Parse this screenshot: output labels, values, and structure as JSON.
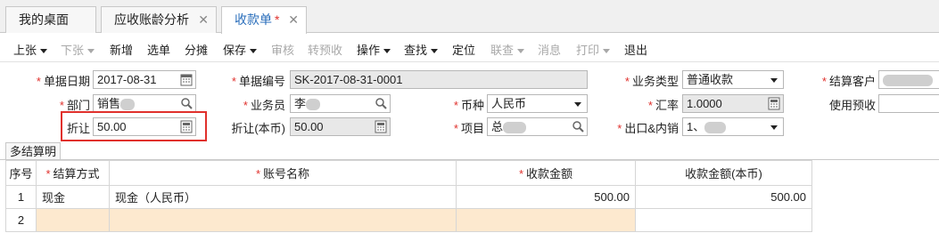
{
  "tabs": [
    {
      "label": "我的桌面",
      "active": false,
      "closable": false
    },
    {
      "label": "应收账龄分析",
      "active": false,
      "closable": true
    },
    {
      "label": "收款单",
      "active": true,
      "closable": true,
      "modified": "*"
    }
  ],
  "toolbar": {
    "items": [
      {
        "label": "上张",
        "dropdown": true,
        "enabled": true
      },
      {
        "label": "下张",
        "dropdown": true,
        "enabled": false
      },
      {
        "label": "新增",
        "enabled": true
      },
      {
        "label": "选单",
        "enabled": true
      },
      {
        "label": "分摊",
        "enabled": true
      },
      {
        "label": "保存",
        "dropdown": true,
        "enabled": true
      },
      {
        "label": "审核",
        "enabled": false
      },
      {
        "label": "转预收",
        "enabled": false
      },
      {
        "label": "操作",
        "dropdown": true,
        "enabled": true
      },
      {
        "label": "查找",
        "dropdown": true,
        "enabled": true
      },
      {
        "label": "定位",
        "enabled": true
      },
      {
        "label": "联查",
        "dropdown": true,
        "enabled": false
      },
      {
        "label": "消息",
        "enabled": false
      },
      {
        "label": "打印",
        "dropdown": true,
        "enabled": false
      },
      {
        "label": "退出",
        "enabled": true
      }
    ]
  },
  "form": {
    "doc_date": {
      "label": "单据日期",
      "value": "2017-08-31"
    },
    "doc_no": {
      "label": "单据编号",
      "value": "SK-2017-08-31-0001"
    },
    "biz_type": {
      "label": "业务类型",
      "value": "普通收款"
    },
    "settle_customer": {
      "label": "结算客户",
      "value": ""
    },
    "dept": {
      "label": "部门",
      "value": "销售"
    },
    "salesman": {
      "label": "业务员",
      "value": "李"
    },
    "currency": {
      "label": "币种",
      "value": "人民币"
    },
    "rate": {
      "label": "汇率",
      "value": "1.0000"
    },
    "use_prepay": {
      "label": "使用预收",
      "value": ""
    },
    "discount": {
      "label": "折让",
      "value": "50.00"
    },
    "discount_base": {
      "label": "折让(本币)",
      "value": "50.00"
    },
    "project": {
      "label": "项目",
      "value": "总"
    },
    "export_domestic": {
      "label": "出口&内销",
      "value": "1、"
    }
  },
  "detail_tab": "多结算明细",
  "table": {
    "headers": [
      "序号",
      "结算方式",
      "账号名称",
      "收款金额",
      "收款金额(本币)"
    ],
    "required": [
      false,
      true,
      true,
      true,
      false
    ],
    "rows": [
      [
        "1",
        "现金",
        "现金（人民币）",
        "500.00",
        "500.00"
      ],
      [
        "2",
        "",
        "",
        "",
        ""
      ]
    ]
  }
}
